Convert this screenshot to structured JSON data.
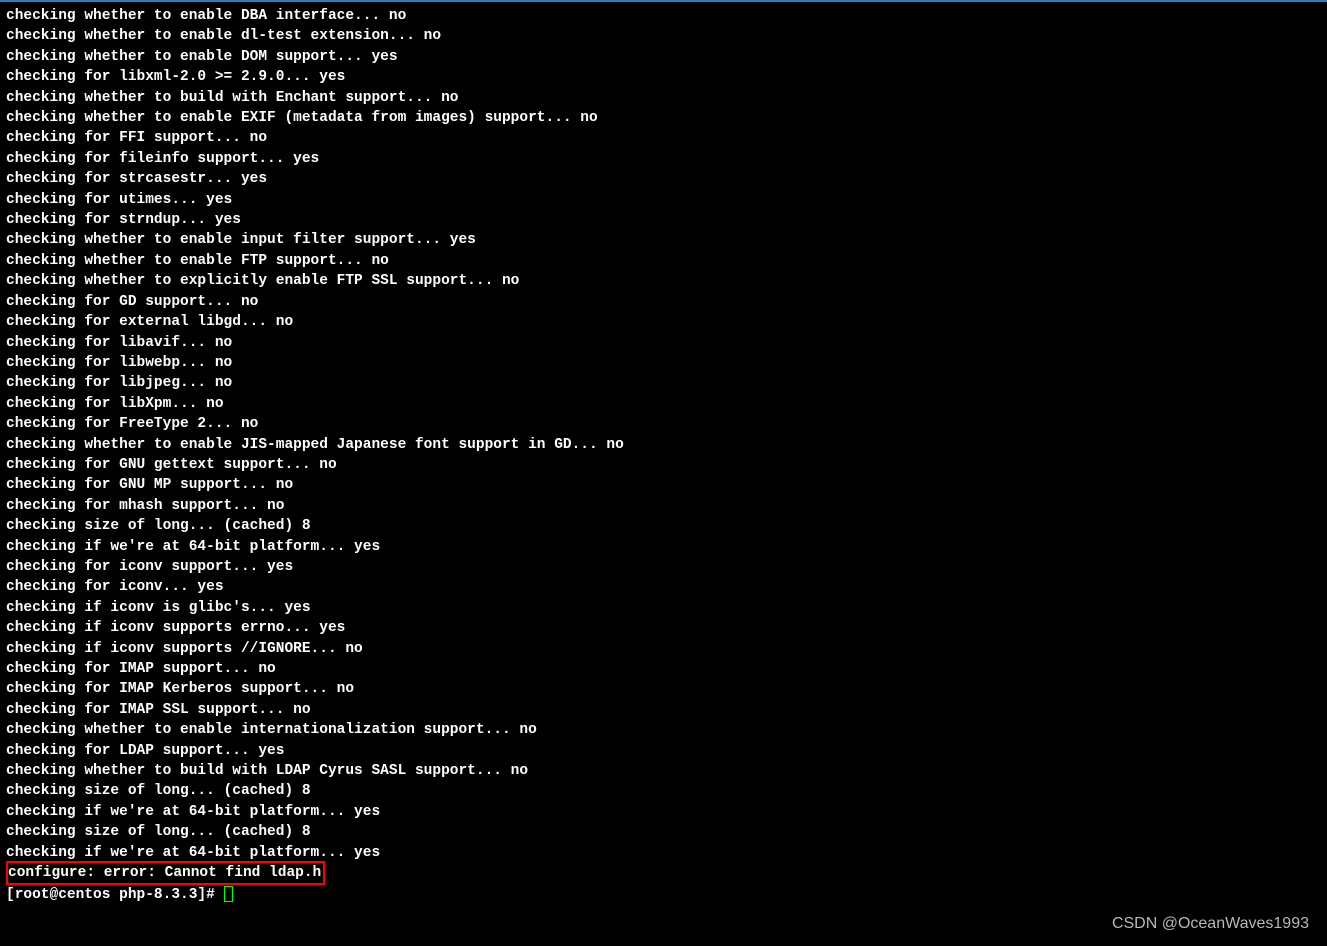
{
  "terminal": {
    "lines": [
      "checking whether to enable DBA interface... no",
      "checking whether to enable dl-test extension... no",
      "checking whether to enable DOM support... yes",
      "checking for libxml-2.0 >= 2.9.0... yes",
      "checking whether to build with Enchant support... no",
      "checking whether to enable EXIF (metadata from images) support... no",
      "checking for FFI support... no",
      "checking for fileinfo support... yes",
      "checking for strcasestr... yes",
      "checking for utimes... yes",
      "checking for strndup... yes",
      "checking whether to enable input filter support... yes",
      "checking whether to enable FTP support... no",
      "checking whether to explicitly enable FTP SSL support... no",
      "checking for GD support... no",
      "checking for external libgd... no",
      "checking for libavif... no",
      "checking for libwebp... no",
      "checking for libjpeg... no",
      "checking for libXpm... no",
      "checking for FreeType 2... no",
      "checking whether to enable JIS-mapped Japanese font support in GD... no",
      "checking for GNU gettext support... no",
      "checking for GNU MP support... no",
      "checking for mhash support... no",
      "checking size of long... (cached) 8",
      "checking if we're at 64-bit platform... yes",
      "checking for iconv support... yes",
      "checking for iconv... yes",
      "checking if iconv is glibc's... yes",
      "checking if iconv supports errno... yes",
      "checking if iconv supports //IGNORE... no",
      "checking for IMAP support... no",
      "checking for IMAP Kerberos support... no",
      "checking for IMAP SSL support... no",
      "checking whether to enable internationalization support... no",
      "checking for LDAP support... yes",
      "checking whether to build with LDAP Cyrus SASL support... no",
      "checking size of long... (cached) 8",
      "checking if we're at 64-bit platform... yes",
      "checking size of long... (cached) 8",
      "checking if we're at 64-bit platform... yes"
    ],
    "highlighted_line": "configure: error: Cannot find ldap.h",
    "prompt": "[root@centos php-8.3.3]# "
  },
  "watermark": "CSDN @OceanWaves1993"
}
